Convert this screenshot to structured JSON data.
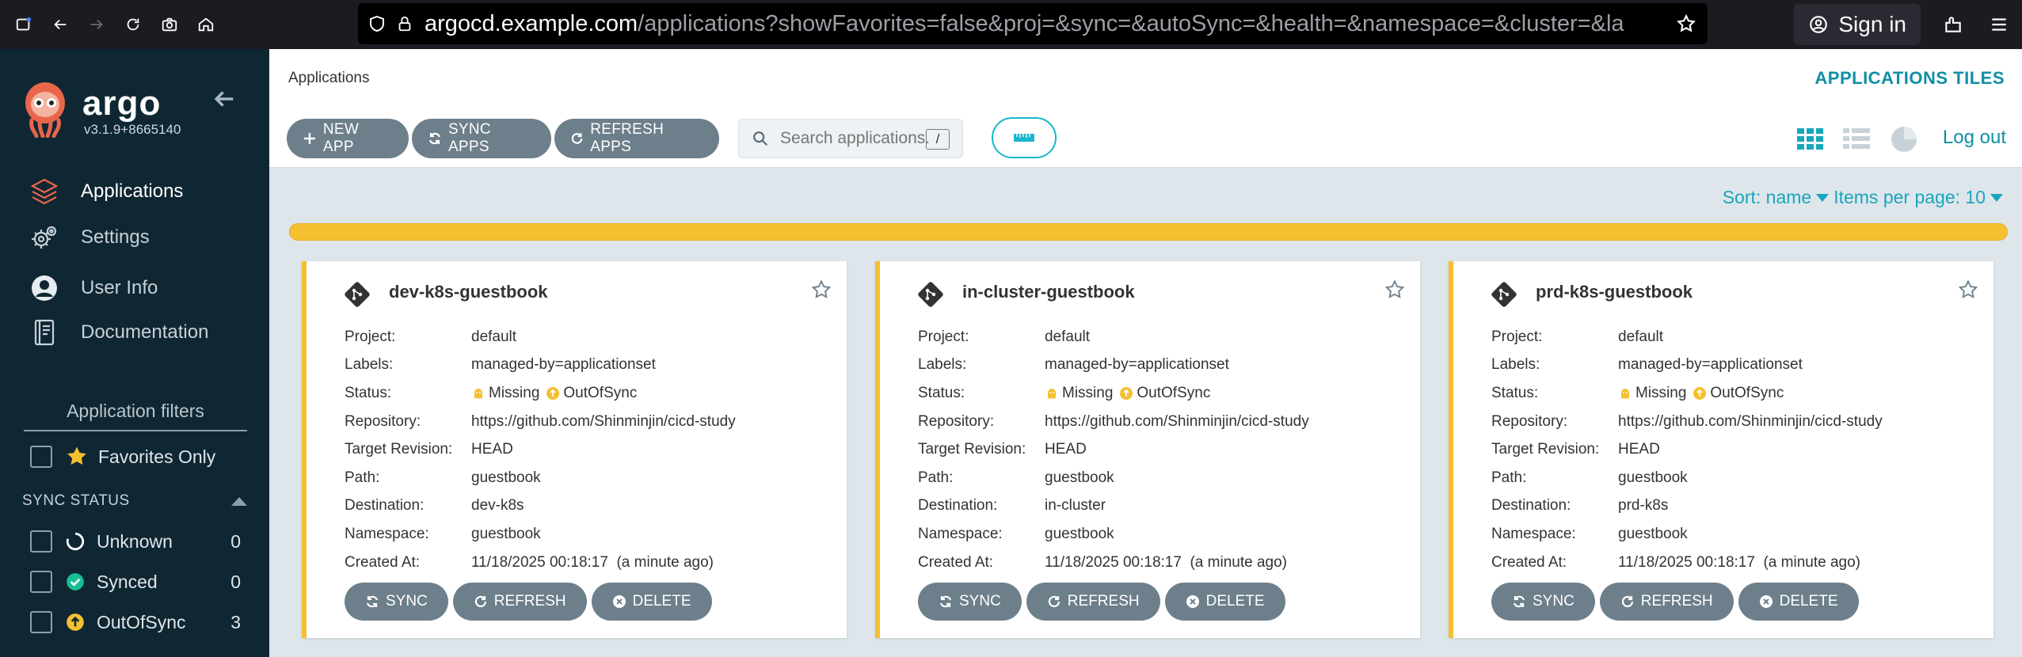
{
  "browser": {
    "url_host": "argocd.example.com",
    "url_path": "/applications?showFavorites=false&proj=&sync=&autoSync=&health=&namespace=&cluster=&la",
    "sign_in": "Sign in"
  },
  "sidebar": {
    "brand": "argo",
    "version": "v3.1.9+8665140",
    "nav": [
      {
        "label": "Applications",
        "icon": "layers-icon"
      },
      {
        "label": "Settings",
        "icon": "gears-icon"
      },
      {
        "label": "User Info",
        "icon": "user-circle-icon"
      },
      {
        "label": "Documentation",
        "icon": "book-icon"
      }
    ],
    "filters_title": "Application filters",
    "favorites_label": "Favorites Only",
    "sync_status_label": "SYNC STATUS",
    "sync_filters": [
      {
        "label": "Unknown",
        "count": "0",
        "color": "#ffffff"
      },
      {
        "label": "Synced",
        "count": "0",
        "color": "#18be94"
      },
      {
        "label": "OutOfSync",
        "count": "3",
        "color": "#f4c030"
      }
    ]
  },
  "header": {
    "breadcrumb": "Applications",
    "title": "APPLICATIONS TILES",
    "new_app": "NEW APP",
    "sync_apps": "SYNC APPS",
    "refresh_apps": "REFRESH APPS",
    "search_placeholder": "Search applications...",
    "search_shortcut": "/",
    "logout": "Log out"
  },
  "content": {
    "sort_label": "Sort: name",
    "items_per_page_label": "Items per page: 10"
  },
  "labels": {
    "project": "Project:",
    "labels": "Labels:",
    "status": "Status:",
    "repository": "Repository:",
    "target_revision": "Target Revision:",
    "path": "Path:",
    "destination": "Destination:",
    "namespace": "Namespace:",
    "created_at": "Created At:",
    "sync": "SYNC",
    "refresh": "REFRESH",
    "delete": "DELETE"
  },
  "applications": [
    {
      "name": "dev-k8s-guestbook",
      "project": "default",
      "labels": "managed-by=applicationset",
      "health": "Missing",
      "sync": "OutOfSync",
      "repository": "https://github.com/Shinminjin/cicd-study",
      "target_revision": "HEAD",
      "path": "guestbook",
      "destination": "dev-k8s",
      "namespace": "guestbook",
      "created_at": "11/18/2025 00:18:17  (a minute ago)"
    },
    {
      "name": "in-cluster-guestbook",
      "project": "default",
      "labels": "managed-by=applicationset",
      "health": "Missing",
      "sync": "OutOfSync",
      "repository": "https://github.com/Shinminjin/cicd-study",
      "target_revision": "HEAD",
      "path": "guestbook",
      "destination": "in-cluster",
      "namespace": "guestbook",
      "created_at": "11/18/2025 00:18:17  (a minute ago)"
    },
    {
      "name": "prd-k8s-guestbook",
      "project": "default",
      "labels": "managed-by=applicationset",
      "health": "Missing",
      "sync": "OutOfSync",
      "repository": "https://github.com/Shinminjin/cicd-study",
      "target_revision": "HEAD",
      "path": "guestbook",
      "destination": "prd-k8s",
      "namespace": "guestbook",
      "created_at": "11/18/2025 00:18:17  (a minute ago)"
    }
  ],
  "colors": {
    "accent": "#0f8fa6",
    "sidebar_bg": "#0f2733",
    "out_of_sync": "#f4c030",
    "button": "#6d7f8b"
  }
}
